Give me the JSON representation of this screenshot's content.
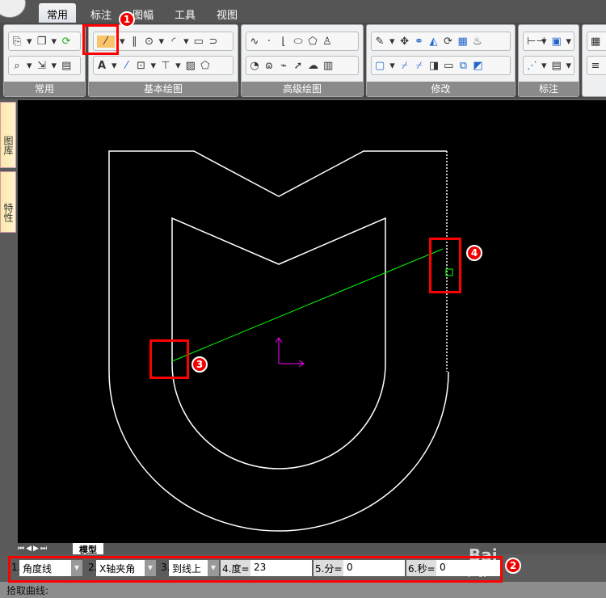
{
  "tabs": [
    {
      "label": "常用",
      "active": true
    },
    {
      "label": "标注"
    },
    {
      "label": "图幅"
    },
    {
      "label": "工具"
    },
    {
      "label": "视图"
    }
  ],
  "groups": [
    {
      "label": "常用"
    },
    {
      "label": "基本绘图"
    },
    {
      "label": "高级绘图"
    },
    {
      "label": "修改"
    },
    {
      "label": "标注"
    }
  ],
  "side_tabs": [
    "图库",
    "特性"
  ],
  "model_tab": "模型",
  "command": {
    "f1_num": "1.",
    "f1_value": "角度线",
    "f2_num": "2.",
    "f2_value": "X轴夹角",
    "f3_num": "3.",
    "f3_value": "到线上",
    "f4_label": "4.度=",
    "f4_value": "23",
    "f5_label": "5.分=",
    "f5_value": "0",
    "f6_label": "6.秒=",
    "f6_value": "0"
  },
  "status_text": "拾取曲线:",
  "badges": [
    "1",
    "2",
    "3",
    "4"
  ],
  "watermark": "Baidu jingyan",
  "colors": {
    "canvas": "#000000",
    "geometry": "#ffffff",
    "preview_line": "#00ff00",
    "ucs": "#ff00ff",
    "highlight": "#ff0000"
  }
}
